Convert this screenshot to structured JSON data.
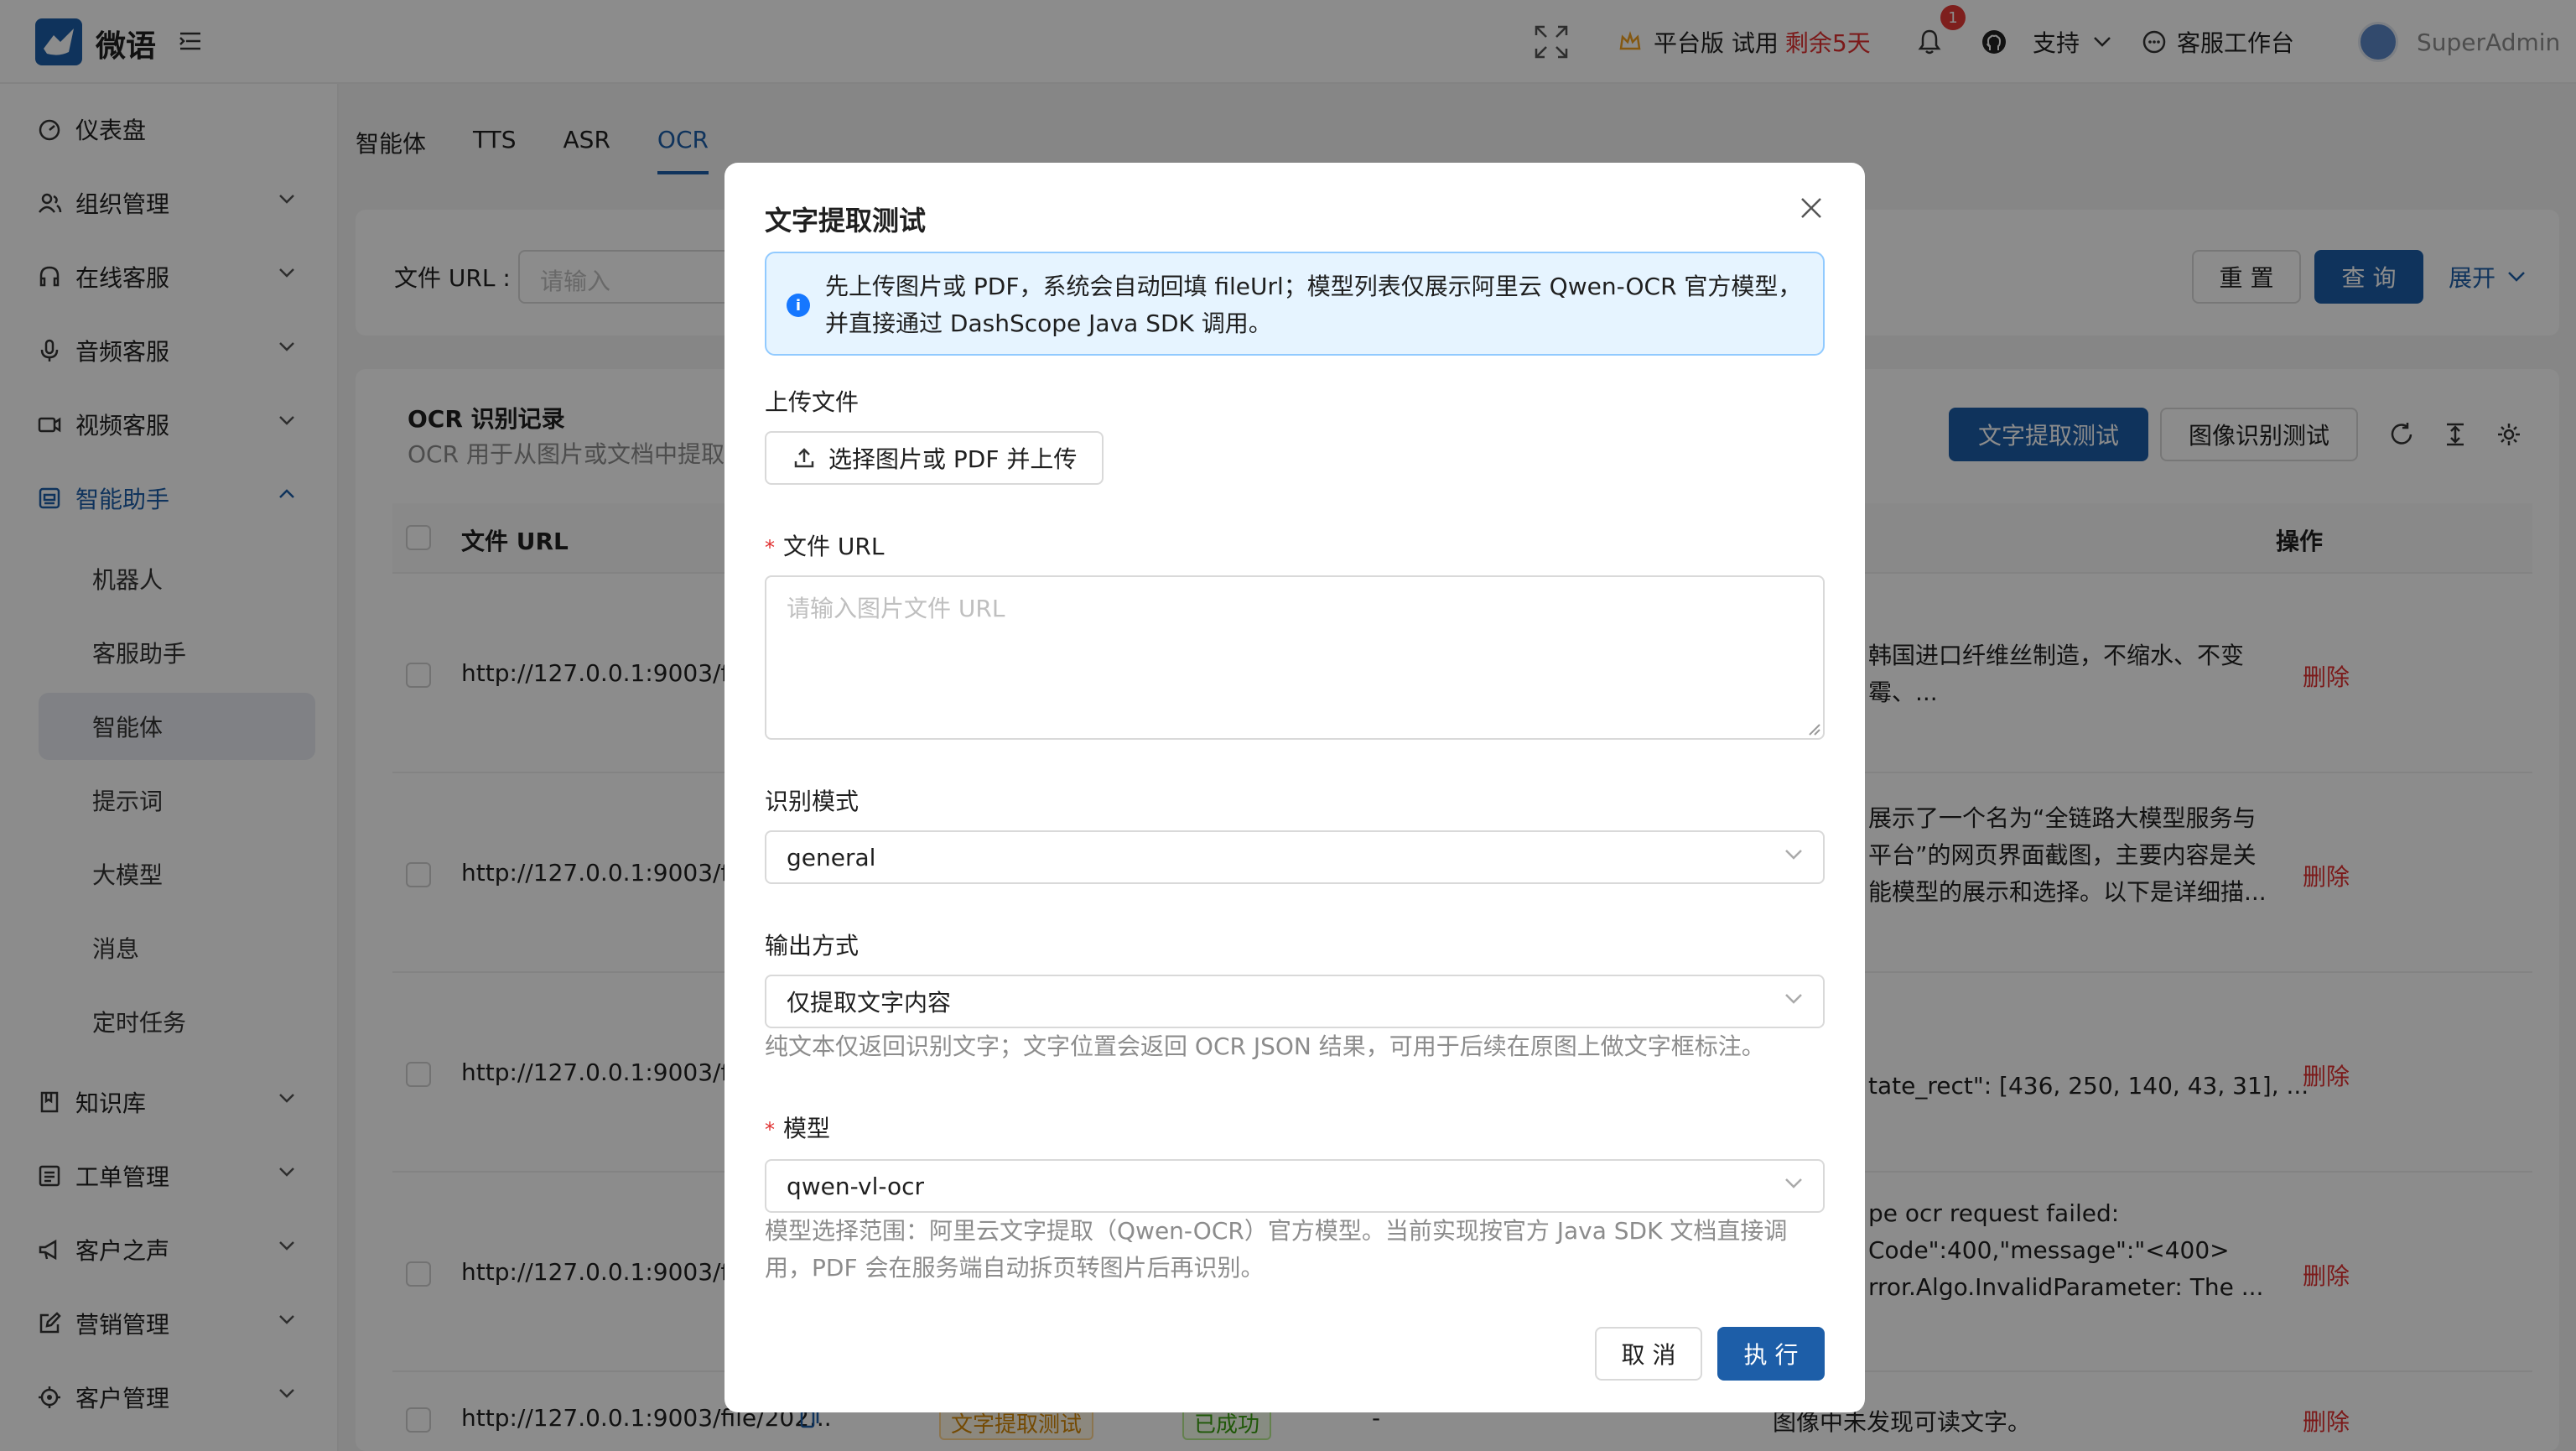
{
  "header": {
    "brand": "微语",
    "trial_label": "平台版 试用",
    "trial_remaining": "剩余5天",
    "notification_count": "1",
    "support_label": "支持",
    "workspace_label": "客服工作台",
    "user_name": "SuperAdmin"
  },
  "sidebar": {
    "items": [
      {
        "label": "仪表盘"
      },
      {
        "label": "组织管理"
      },
      {
        "label": "在线客服"
      },
      {
        "label": "音频客服"
      },
      {
        "label": "视频客服"
      },
      {
        "label": "智能助手"
      },
      {
        "label": "知识库"
      },
      {
        "label": "工单管理"
      },
      {
        "label": "客户之声"
      },
      {
        "label": "营销管理"
      },
      {
        "label": "客户管理"
      }
    ],
    "subitems": [
      {
        "label": "机器人"
      },
      {
        "label": "客服助手"
      },
      {
        "label": "智能体"
      },
      {
        "label": "提示词"
      },
      {
        "label": "大模型"
      },
      {
        "label": "消息"
      },
      {
        "label": "定时任务"
      }
    ]
  },
  "tabs": [
    {
      "label": "智能体"
    },
    {
      "label": "TTS"
    },
    {
      "label": "ASR"
    },
    {
      "label": "OCR"
    }
  ],
  "filter": {
    "file_url_label": "文件 URL :",
    "placeholder": "请输入",
    "reset": "重 置",
    "query": "查 询",
    "expand": "展开"
  },
  "records": {
    "title": "OCR 识别记录",
    "subtitle": "OCR 用于从图片或文档中提取",
    "text_extract_btn": "文字提取测试",
    "image_recog_btn": "图像识别测试",
    "col_file_url": "文件 URL",
    "col_action": "操作",
    "rows": [
      {
        "url": "http://127.0.0.1:9003/file/",
        "result_1": "韩国进口纤维丝制造，不缩水、不变",
        "result_2": "霉、...",
        "action": "删除"
      },
      {
        "url": "http://127.0.0.1:9003/file/",
        "result_1": "展示了一个名为“全链路大模型服务与",
        "result_2": "平台”的网页界面截图，主要内容是关",
        "result_3": "能模型的展示和选择。以下是详细描...",
        "action": "删除"
      },
      {
        "url": "http://127.0.0.1:9003/file/",
        "result_1": "tate_rect\": [436, 250, 140, 43, 31], ...",
        "action": "删除"
      },
      {
        "url": "http://127.0.0.1:9003/file/",
        "result_1": "pe ocr request failed:",
        "result_2": "Code\":400,\"message\":\"<400>",
        "result_3": "rror.Algo.InvalidParameter: The ...",
        "action": "删除"
      },
      {
        "url": "http://127.0.0.1:9003/file/202...",
        "type": "文字提取测试",
        "status": "已成功",
        "dash": "-",
        "result_1": "图像中未发现可读文字。",
        "action": "删除"
      }
    ]
  },
  "modal": {
    "title": "文字提取测试",
    "alert_text": "先上传图片或 PDF，系统会自动回填 fileUrl；模型列表仅展示阿里云 Qwen-OCR 官方模型，并直接通过 DashScope Java SDK 调用。",
    "upload_label": "上传文件",
    "upload_button": "选择图片或 PDF 并上传",
    "file_url_label": "文件 URL",
    "file_url_placeholder": "请输入图片文件 URL",
    "mode_label": "识别模式",
    "mode_value": "general",
    "output_label": "输出方式",
    "output_value": "仅提取文字内容",
    "output_help": "纯文本仅返回识别文字；文字位置会返回 OCR JSON 结果，可用于后续在原图上做文字框标注。",
    "model_label": "模型",
    "model_value": "qwen-vl-ocr",
    "model_help": "模型选择范围：阿里云文字提取（Qwen-OCR）官方模型。当前实现按官方 Java SDK 文档直接调用，PDF 会在服务端自动拆页转图片后再识别。",
    "cancel": "取 消",
    "execute": "执 行"
  },
  "colors": {
    "primary": "#1d5ea8",
    "danger": "#e03030",
    "alert_bg": "#e6f4ff",
    "alert_border": "#91caff"
  }
}
